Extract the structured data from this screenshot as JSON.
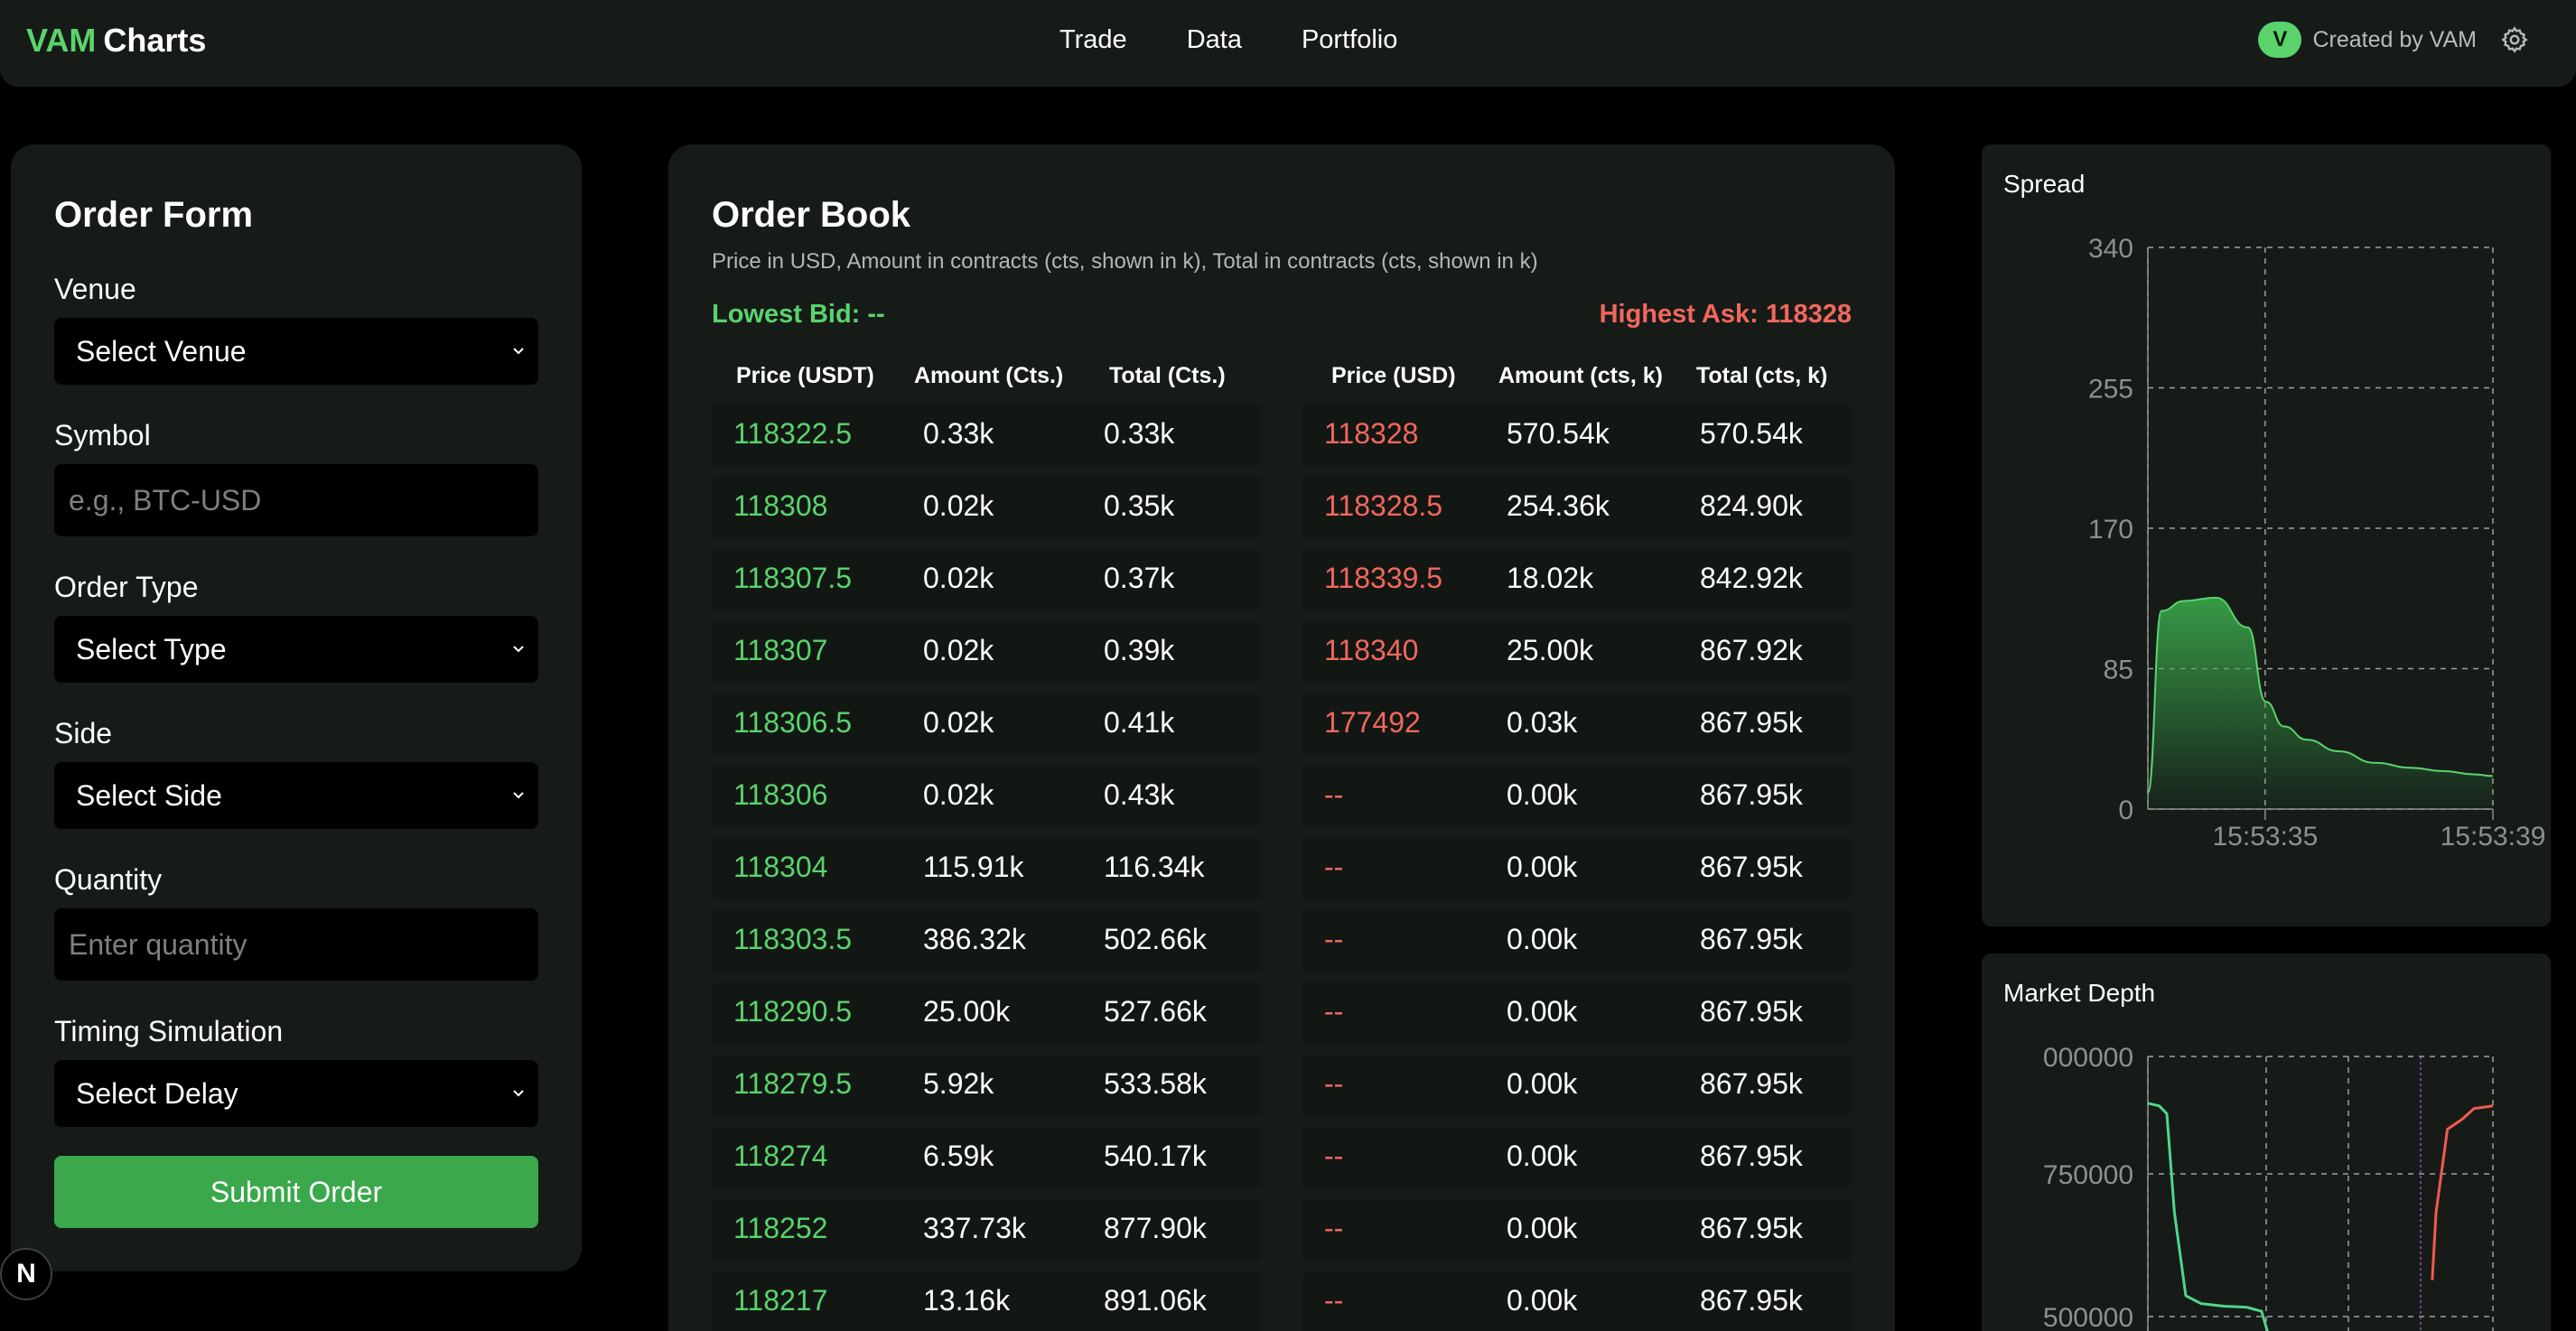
{
  "nav": {
    "brand_accent": "VAM",
    "brand_rest": "Charts",
    "links": [
      "Trade",
      "Data",
      "Portfolio"
    ],
    "avatar_letter": "V",
    "created_by": "Created by VAM",
    "settings_icon": "gear-icon"
  },
  "colors": {
    "accent": "#5ad36c",
    "bid": "#5ad36c",
    "ask": "#f2675d",
    "button": "#3aa84b",
    "panel": "#161b18",
    "ask_line": "#f25a4e"
  },
  "order_form": {
    "title": "Order Form",
    "venue_label": "Venue",
    "venue_value": "Select Venue",
    "symbol_label": "Symbol",
    "symbol_placeholder": "e.g., BTC-USD",
    "order_type_label": "Order Type",
    "order_type_value": "Select Type",
    "side_label": "Side",
    "side_value": "Select Side",
    "quantity_label": "Quantity",
    "quantity_placeholder": "Enter quantity",
    "timing_label": "Timing Simulation",
    "timing_value": "Select Delay",
    "submit_label": "Submit Order"
  },
  "dev_badge": "N",
  "order_book": {
    "title": "Order Book",
    "subtitle": "Price in USD, Amount in contracts (cts, shown in k), Total in contracts (cts, shown in k)",
    "lowest_bid": "Lowest Bid: --",
    "highest_ask": "Highest Ask: 118328",
    "bid_headers": [
      "Price (USDT)",
      "Amount (Cts.)",
      "Total (Cts.)"
    ],
    "ask_headers": [
      "Price (USD)",
      "Amount (cts, k)",
      "Total (cts, k)"
    ],
    "bids": [
      [
        "118322.5",
        "0.33k",
        "0.33k"
      ],
      [
        "118308",
        "0.02k",
        "0.35k"
      ],
      [
        "118307.5",
        "0.02k",
        "0.37k"
      ],
      [
        "118307",
        "0.02k",
        "0.39k"
      ],
      [
        "118306.5",
        "0.02k",
        "0.41k"
      ],
      [
        "118306",
        "0.02k",
        "0.43k"
      ],
      [
        "118304",
        "115.91k",
        "116.34k"
      ],
      [
        "118303.5",
        "386.32k",
        "502.66k"
      ],
      [
        "118290.5",
        "25.00k",
        "527.66k"
      ],
      [
        "118279.5",
        "5.92k",
        "533.58k"
      ],
      [
        "118274",
        "6.59k",
        "540.17k"
      ],
      [
        "118252",
        "337.73k",
        "877.90k"
      ],
      [
        "118217",
        "13.16k",
        "891.06k"
      ]
    ],
    "asks": [
      [
        "118328",
        "570.54k",
        "570.54k"
      ],
      [
        "118328.5",
        "254.36k",
        "824.90k"
      ],
      [
        "118339.5",
        "18.02k",
        "842.92k"
      ],
      [
        "118340",
        "25.00k",
        "867.92k"
      ],
      [
        "177492",
        "0.03k",
        "867.95k"
      ],
      [
        "--",
        "0.00k",
        "867.95k"
      ],
      [
        "--",
        "0.00k",
        "867.95k"
      ],
      [
        "--",
        "0.00k",
        "867.95k"
      ],
      [
        "--",
        "0.00k",
        "867.95k"
      ],
      [
        "--",
        "0.00k",
        "867.95k"
      ],
      [
        "--",
        "0.00k",
        "867.95k"
      ],
      [
        "--",
        "0.00k",
        "867.95k"
      ],
      [
        "--",
        "0.00k",
        "867.95k"
      ]
    ]
  },
  "spread_chart": {
    "title": "Spread",
    "chart_data": {
      "type": "area",
      "ylim": [
        0,
        340
      ],
      "yticks": [
        340,
        255,
        170,
        85,
        0
      ],
      "xticks": [
        "15:53:35",
        "15:53:39"
      ],
      "grid": true,
      "x": [
        0.0,
        0.3,
        0.8,
        1.5,
        2.2,
        2.6,
        3.0,
        3.5,
        4.2,
        5.0,
        5.8,
        6.5,
        7.2,
        7.6
      ],
      "y": [
        10,
        120,
        126,
        128,
        110,
        65,
        50,
        42,
        35,
        28,
        25,
        23,
        21,
        20
      ],
      "fill": "#3aa84b",
      "line": "#5ad36c"
    }
  },
  "depth_chart": {
    "title": "Market Depth",
    "chart_data": {
      "type": "line",
      "ylim": [
        500000,
        1000000
      ],
      "ytick_labels": [
        "000000",
        "750000",
        "500000"
      ],
      "grid": true,
      "series": [
        {
          "x": [
            0.0,
            0.3,
            0.5,
            0.7,
            1.0,
            1.4,
            2.0,
            2.6,
            3.0,
            3.2
          ],
          "y": [
            910000,
            905000,
            890000,
            700000,
            540000,
            525000,
            520000,
            518000,
            510000,
            460000
          ],
          "color": "#4fd68a"
        },
        {
          "x": [
            7.5,
            7.6,
            7.9,
            8.3,
            8.6,
            9.1
          ],
          "y": [
            570000,
            700000,
            860000,
            880000,
            900000,
            905000
          ],
          "color": "#f25a4e"
        }
      ]
    }
  }
}
